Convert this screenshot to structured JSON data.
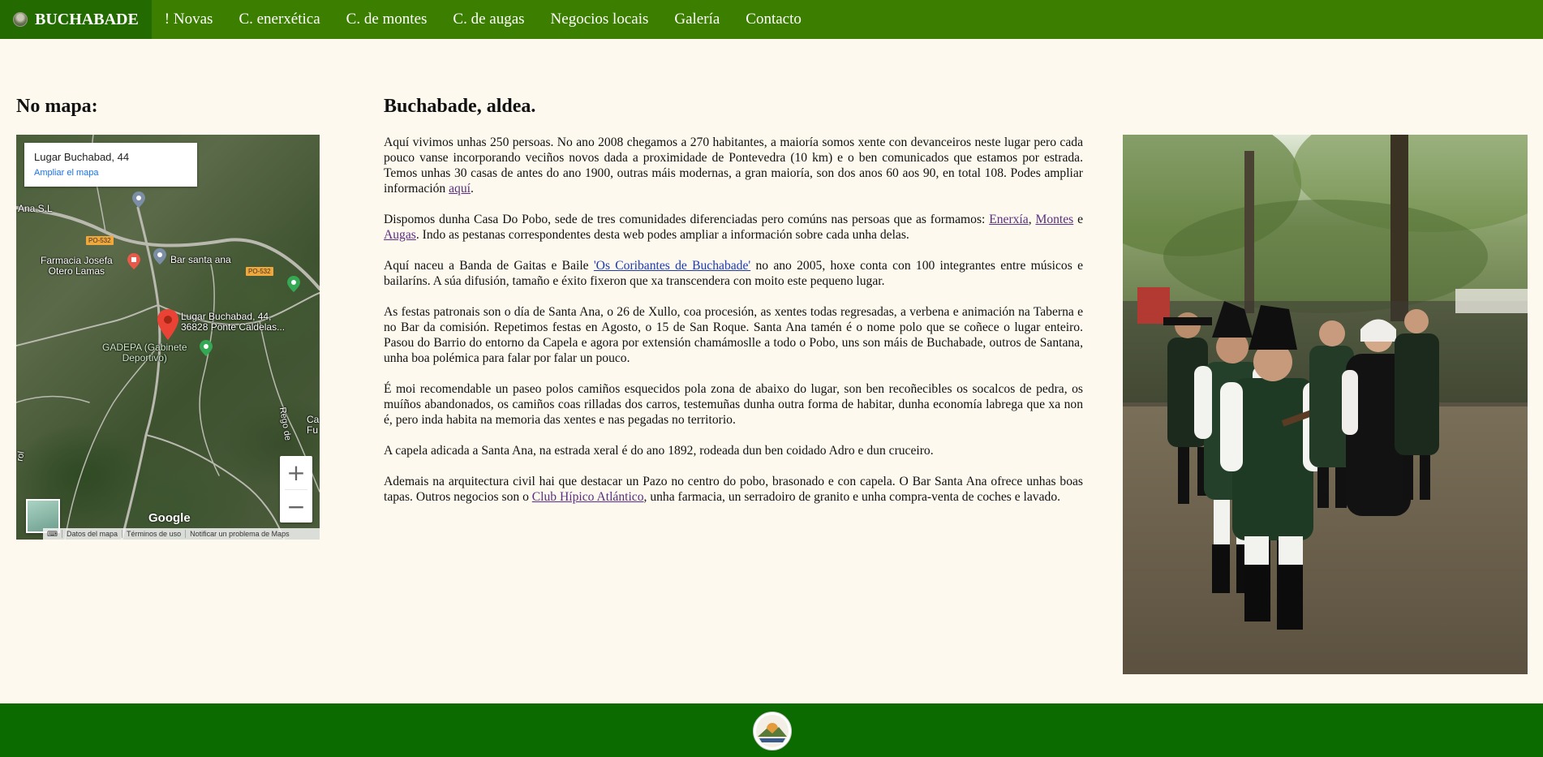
{
  "nav": {
    "brand": "BUCHABADE",
    "items": [
      {
        "label": "! Novas"
      },
      {
        "label": "C. enerxética"
      },
      {
        "label": "C. de montes"
      },
      {
        "label": "C. de augas"
      },
      {
        "label": "Negocios locais"
      },
      {
        "label": "Galería"
      },
      {
        "label": "Contacto"
      }
    ]
  },
  "map_section": {
    "heading": "No mapa:",
    "card": {
      "place": "Lugar Buchabad, 44",
      "enlarge": "Ampliar el mapa"
    },
    "labels": {
      "ana_sl": "Ana S.L",
      "farmacia": "Farmacia Josefa\nOtero Lamas",
      "bar": "Bar santa ana",
      "lugar": "Lugar Buchabad, 44,\n36828 Ponte Caldelas...",
      "gadepa": "GADEPA (Gabinete\nDeportivo)",
      "rego": "Rego de",
      "ca": "Ca\nFu",
      "rol": "rol",
      "road1": "PO-532",
      "road2": "PO-532"
    },
    "zoom_in": "+",
    "zoom_out": "−",
    "google": "Google",
    "footer": {
      "data": "Datos del mapa",
      "terms": "Términos de uso",
      "report": "Notificar un problema de Maps"
    }
  },
  "article": {
    "heading": "Buchabade, aldea.",
    "p1_text": "Aquí vivimos unhas 250 persoas. No ano 2008 chegamos a 270 habitantes, a maioría somos xente con devanceiros neste lugar pero cada pouco vanse incorporando veciños novos dada a proximidade de Pontevedra (10 km) e o ben comunicados que estamos por estrada. Temos unhas 30 casas de antes do ano 1900, outras máis modernas, a gran maioría, son dos anos 60 aos 90, en total 108. Podes ampliar información ",
    "p1_link": "aquí",
    "p1_end": ".",
    "p2_text": "Dispomos dunha Casa Do Pobo, sede de tres comunidades diferenciadas pero comúns nas persoas que as formamos: ",
    "p2_link1": "Enerxía",
    "p2_sep1": ", ",
    "p2_link2": "Montes",
    "p2_sep2": " e ",
    "p2_link3": "Augas",
    "p2_end": ". Indo as pestanas correspondentes desta web podes ampliar a información sobre cada unha delas.",
    "p3_text": "Aquí naceu a Banda de Gaitas e Baile ",
    "p3_link": "'Os Coribantes de Buchabade'",
    "p3_end": " no ano 2005, hoxe conta con 100 integrantes entre músicos e bailaríns. A súa difusión, tamaño e éxito fixeron que xa transcendera con moito este pequeno lugar.",
    "p4": "As festas patronais son o día de Santa Ana, o 26 de Xullo, coa procesión, as xentes todas regresadas, a verbena e animación na Taberna e no Bar da comisión. Repetimos festas en Agosto, o 15 de San Roque. Santa Ana tamén é o nome polo que se coñece o lugar enteiro. Pasou do Barrio do entorno da Capela e agora por extensión chamámoslle a todo o Pobo, uns son máis de Buchabade, outros de Santana, unha boa polémica para falar por falar un pouco.",
    "p5": "É moi recomendable un paseo polos camiños esquecidos pola zona de abaixo do lugar, son ben recoñecibles os socalcos de pedra, os muíños abandonados, os camiños coas rilladas dos carros, testemuñas dunha outra forma de habitar, dunha economía labrega que xa non é, pero inda habita na memoria das xentes e nas pegadas no territorio.",
    "p6": "A capela adicada a Santa Ana, na estrada xeral é do ano 1892, rodeada dun ben coidado Adro e dun cruceiro.",
    "p7_text": "Ademais na arquitectura civil hai que destacar un Pazo no centro do pobo, brasonado e con capela. O Bar Santa Ana ofrece unhas boas tapas. Outros negocios son o ",
    "p7_link": "Club Hípico Atlántico",
    "p7_end": ", unha farmacia, un serradoiro de granito e unha compra-venta de coches e lavado."
  },
  "colors": {
    "nav": "#3c7f00",
    "brand_bg": "#236b00",
    "page_bg": "#fdf9ee",
    "footer": "#0b6b00",
    "link": "#5a2d82"
  }
}
